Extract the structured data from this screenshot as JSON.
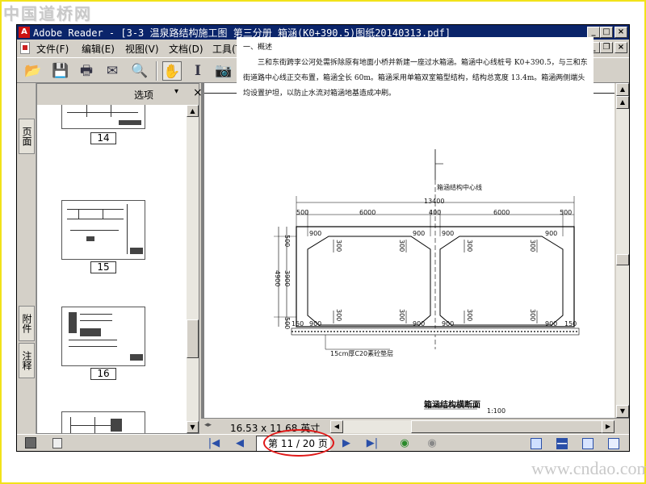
{
  "watermarks": {
    "top": "中国道桥网",
    "bottom": "www.cndao.com"
  },
  "window": {
    "title": "Adobe Reader - [3-3 温泉路结构施工图 第三分册 箱涵(K0+390.5)图纸20140313.pdf]",
    "icon_glyph": "A",
    "controls": [
      "_",
      "□",
      "×"
    ],
    "doc_controls": [
      "_",
      "❐",
      "×"
    ]
  },
  "menu": {
    "items": [
      "文件(F)",
      "编辑(E)",
      "视图(V)",
      "文档(D)",
      "工具(T)"
    ]
  },
  "toolbar": {
    "icons": [
      "open-icon",
      "save-icon",
      "print-icon",
      "email-icon",
      "search-icon",
      "hand-tool-icon",
      "select-text-icon",
      "snapshot-icon"
    ],
    "glyphs": [
      "📂",
      "💾",
      "🖶",
      "✉",
      "🔍",
      "✋",
      "I",
      "📷"
    ]
  },
  "side_tabs": {
    "pages": "页面",
    "attachments": "附件",
    "comments": "注释"
  },
  "thumbnails_panel": {
    "options_label": "选项",
    "options_arrow": "▾",
    "close_glyph": "×",
    "pages": [
      "14",
      "15",
      "16"
    ]
  },
  "document": {
    "overview_heading": "一、概述",
    "overview_body": "三和东街跨李公河处需拆除原有地面小桥并新建一座过水箱涵。箱涵中心线桩号 K0+390.5，与三和东街道路中心线正交布置，箱涵全长 60m。箱涵采用单箱双室箱型结构，结构总宽度 13.4m。箱涵两侧端头均设置护坦，以防止水流对箱涵地基造成冲刷。",
    "drawing": {
      "centerline_label": "箱涵结构中心线",
      "total_width": "13400",
      "segments": [
        "500",
        "6000",
        "400",
        "6000",
        "500"
      ],
      "haunch_top": [
        "900",
        "900",
        "900",
        "900"
      ],
      "haunch_bottom": [
        "900",
        "900",
        "900",
        "900"
      ],
      "side_dims": [
        "500",
        "3900",
        "4900",
        "500"
      ],
      "small_dims": [
        "300",
        "300",
        "300",
        "300",
        "300",
        "300",
        "300",
        "300"
      ],
      "edge_dims": [
        "150",
        "150"
      ],
      "bedding_note": "15cm厚C20素砼垫层",
      "caption": "箱涵结构横断面",
      "scale": "1:100"
    }
  },
  "status_bar": {
    "page_size": "16.53 x 11.68 英寸"
  },
  "navigation": {
    "page_display": "第 11 / 20 页",
    "buttons": [
      "|◀",
      "◀",
      "▶",
      "▶|"
    ],
    "history": [
      "◉",
      "◉"
    ]
  },
  "colors": {
    "titlebar": "#0a246a",
    "highlight": "#e01818",
    "frame": "#f2e21a",
    "chrome": "#d4d0c8"
  }
}
